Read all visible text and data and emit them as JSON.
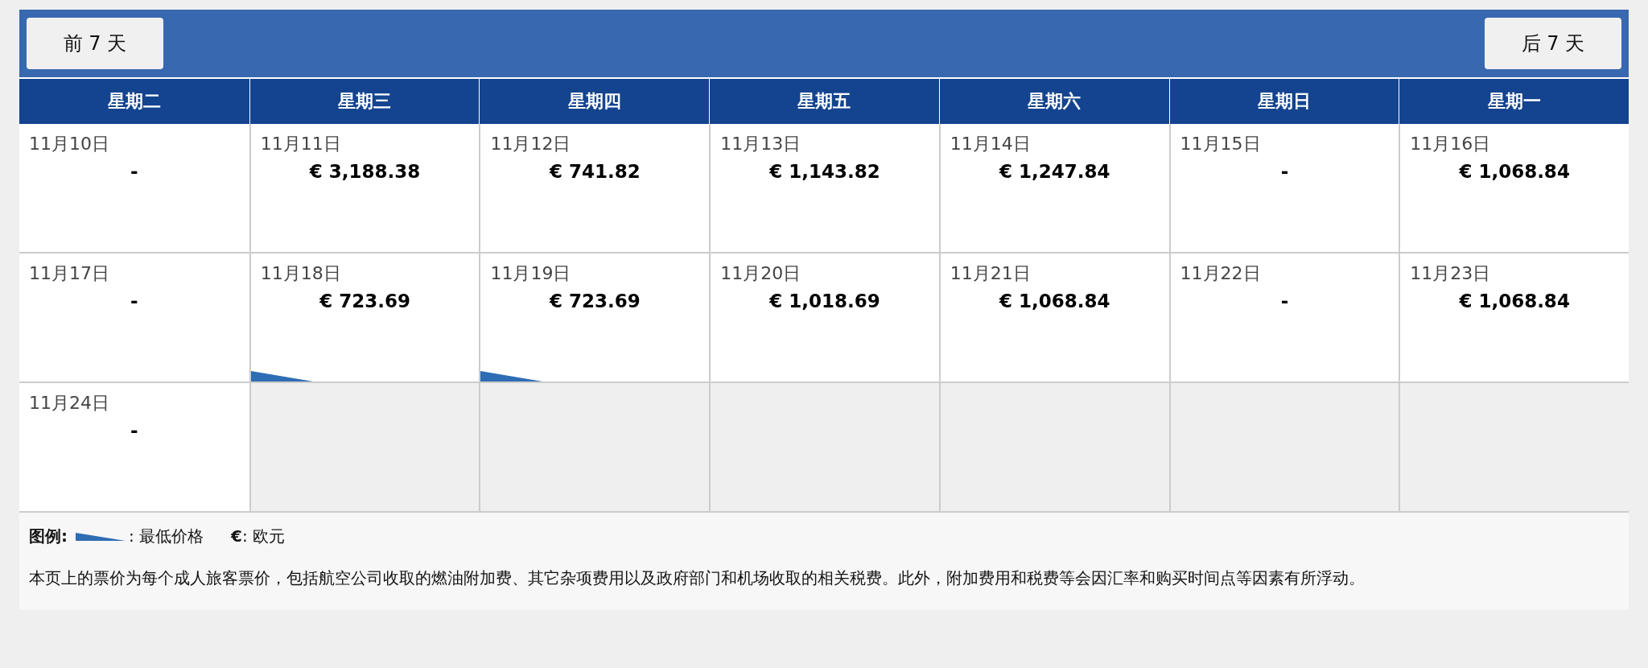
{
  "nav": {
    "prev": "前 7 天",
    "next": "后 7 天"
  },
  "weekdays": [
    "星期二",
    "星期三",
    "星期四",
    "星期五",
    "星期六",
    "星期日",
    "星期一"
  ],
  "rows": [
    [
      {
        "kind": "day",
        "date": "11月10日",
        "price": "-",
        "lowest": false
      },
      {
        "kind": "day",
        "date": "11月11日",
        "price": "€ 3,188.38",
        "lowest": false
      },
      {
        "kind": "day",
        "date": "11月12日",
        "price": "€ 741.82",
        "lowest": false
      },
      {
        "kind": "day",
        "date": "11月13日",
        "price": "€ 1,143.82",
        "lowest": false
      },
      {
        "kind": "day",
        "date": "11月14日",
        "price": "€ 1,247.84",
        "lowest": false
      },
      {
        "kind": "day",
        "date": "11月15日",
        "price": "-",
        "lowest": false
      },
      {
        "kind": "day",
        "date": "11月16日",
        "price": "€ 1,068.84",
        "lowest": false
      }
    ],
    [
      {
        "kind": "day",
        "date": "11月17日",
        "price": "-",
        "lowest": false
      },
      {
        "kind": "day",
        "date": "11月18日",
        "price": "€ 723.69",
        "lowest": true
      },
      {
        "kind": "day",
        "date": "11月19日",
        "price": "€ 723.69",
        "lowest": true
      },
      {
        "kind": "day",
        "date": "11月20日",
        "price": "€ 1,018.69",
        "lowest": false
      },
      {
        "kind": "day",
        "date": "11月21日",
        "price": "€ 1,068.84",
        "lowest": false
      },
      {
        "kind": "day",
        "date": "11月22日",
        "price": "-",
        "lowest": false
      },
      {
        "kind": "day",
        "date": "11月23日",
        "price": "€ 1,068.84",
        "lowest": false
      }
    ],
    [
      {
        "kind": "day",
        "date": "11月24日",
        "price": "-",
        "lowest": false
      },
      {
        "kind": "empty"
      },
      {
        "kind": "empty"
      },
      {
        "kind": "empty"
      },
      {
        "kind": "empty"
      },
      {
        "kind": "empty"
      },
      {
        "kind": "empty"
      }
    ]
  ],
  "legend": {
    "title": "图例:",
    "lowest_label": ": 最低价格",
    "currency": "**€**: 欧元"
  },
  "note": "本页上的票价为每个成人旅客票价，包括航空公司收取的燃油附加费、其它杂项费用以及政府部门和机场收取的相关税费。此外，附加费用和税费等会因汇率和购买时间点等因素有所浮动。"
}
